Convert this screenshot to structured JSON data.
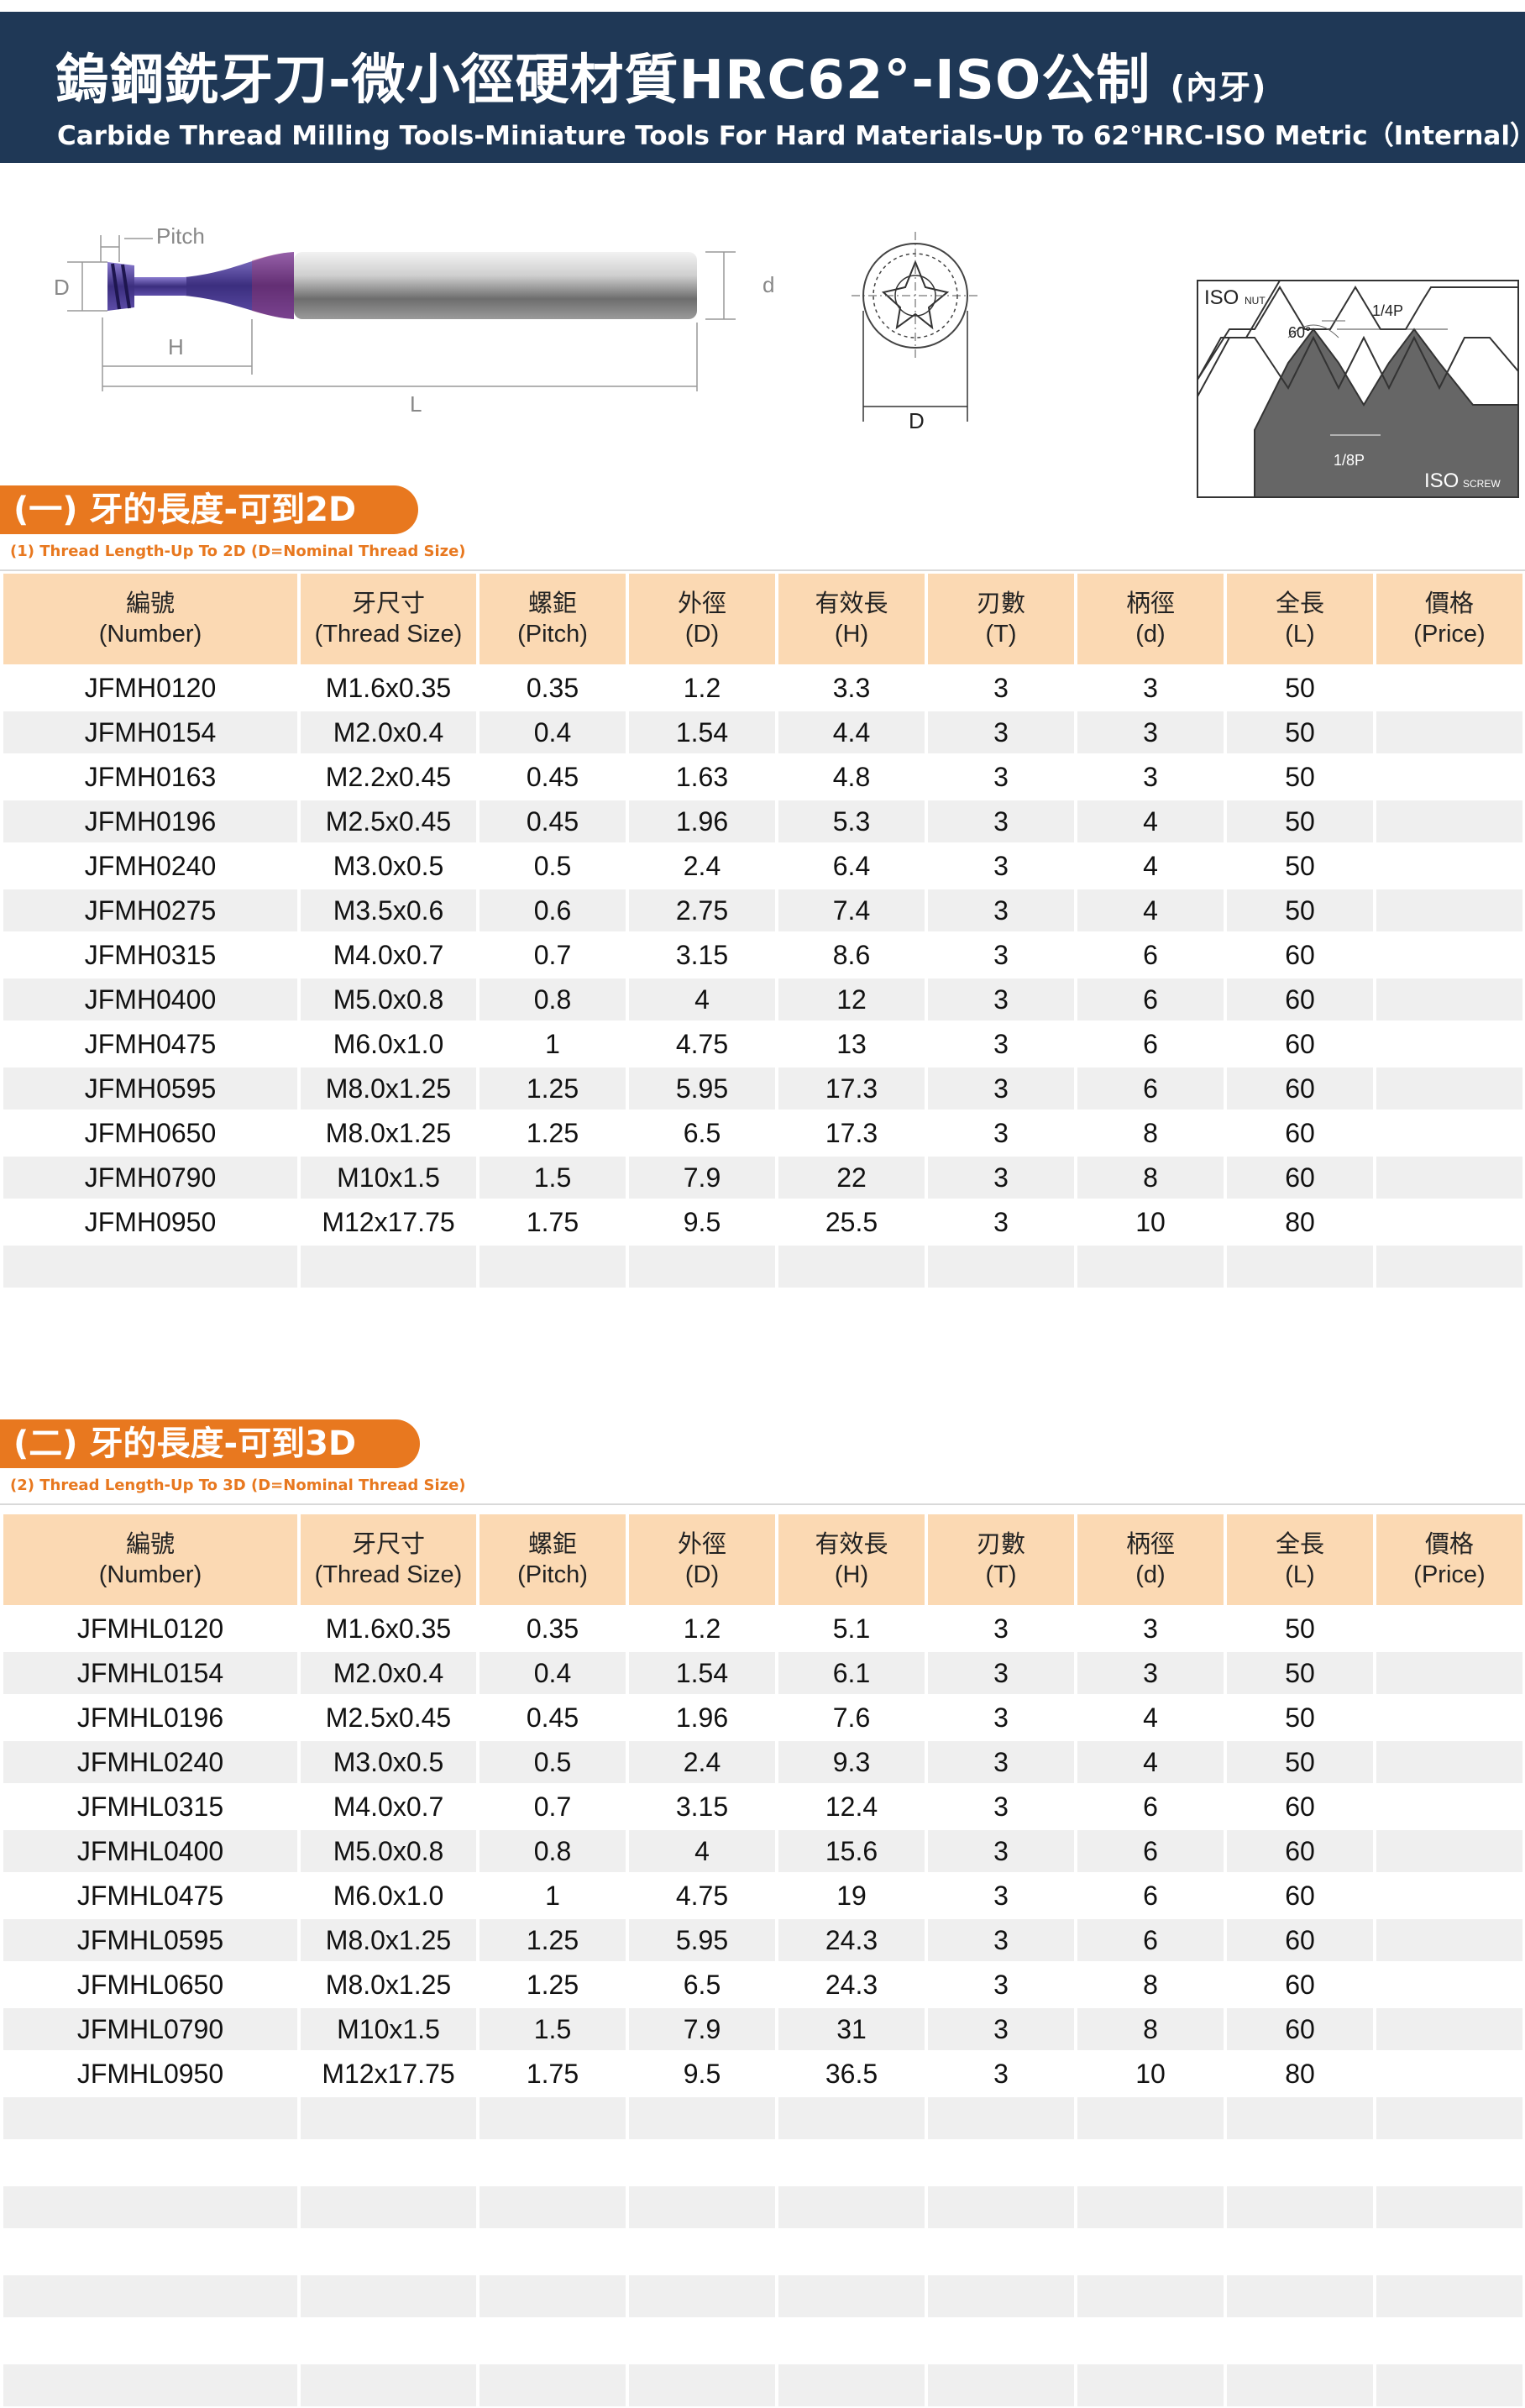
{
  "header": {
    "title_zh": "鎢鋼銑牙刀-微小徑硬材質HRC62°-ISO公制",
    "title_suffix": "(內牙)",
    "subtitle": "Carbide Thread Milling Tools-Miniature Tools For Hard Materials-Up To 62°HRC-ISO Metric（Internal）"
  },
  "tool_diagram": {
    "pitch_label": "Pitch",
    "d_outer_label": "D",
    "h_label": "H",
    "l_label": "L",
    "d_shank_label": "d",
    "end_view_label": "D"
  },
  "iso_diagram": {
    "nut_label": "ISO",
    "nut_sub": "NUT",
    "angle_label": "60°",
    "quarter_p": "1/4P",
    "eighth_p": "1/8P",
    "screw_label": "ISO",
    "screw_sub": "SCREW"
  },
  "columns": [
    {
      "zh": "編號",
      "en": "(Number)"
    },
    {
      "zh": "牙尺寸",
      "en": "(Thread Size)"
    },
    {
      "zh": "螺鉅",
      "en": "(Pitch)"
    },
    {
      "zh": "外徑",
      "en": "(D)"
    },
    {
      "zh": "有效長",
      "en": "(H)"
    },
    {
      "zh": "刃數",
      "en": "(T)"
    },
    {
      "zh": "柄徑",
      "en": "(d)"
    },
    {
      "zh": "全長",
      "en": "(L)"
    },
    {
      "zh": "價格",
      "en": "(Price)"
    }
  ],
  "section1": {
    "title": "(一) 牙的長度-可到2D",
    "subtitle": "(1) Thread Length-Up To 2D  (D=Nominal Thread Size)",
    "rows": [
      [
        "JFMH0120",
        "M1.6x0.35",
        "0.35",
        "1.2",
        "3.3",
        "3",
        "3",
        "50",
        ""
      ],
      [
        "JFMH0154",
        "M2.0x0.4",
        "0.4",
        "1.54",
        "4.4",
        "3",
        "3",
        "50",
        ""
      ],
      [
        "JFMH0163",
        "M2.2x0.45",
        "0.45",
        "1.63",
        "4.8",
        "3",
        "3",
        "50",
        ""
      ],
      [
        "JFMH0196",
        "M2.5x0.45",
        "0.45",
        "1.96",
        "5.3",
        "3",
        "4",
        "50",
        ""
      ],
      [
        "JFMH0240",
        "M3.0x0.5",
        "0.5",
        "2.4",
        "6.4",
        "3",
        "4",
        "50",
        ""
      ],
      [
        "JFMH0275",
        "M3.5x0.6",
        "0.6",
        "2.75",
        "7.4",
        "3",
        "4",
        "50",
        ""
      ],
      [
        "JFMH0315",
        "M4.0x0.7",
        "0.7",
        "3.15",
        "8.6",
        "3",
        "6",
        "60",
        ""
      ],
      [
        "JFMH0400",
        "M5.0x0.8",
        "0.8",
        "4",
        "12",
        "3",
        "6",
        "60",
        ""
      ],
      [
        "JFMH0475",
        "M6.0x1.0",
        "1",
        "4.75",
        "13",
        "3",
        "6",
        "60",
        ""
      ],
      [
        "JFMH0595",
        "M8.0x1.25",
        "1.25",
        "5.95",
        "17.3",
        "3",
        "6",
        "60",
        ""
      ],
      [
        "JFMH0650",
        "M8.0x1.25",
        "1.25",
        "6.5",
        "17.3",
        "3",
        "8",
        "60",
        ""
      ],
      [
        "JFMH0790",
        "M10x1.5",
        "1.5",
        "7.9",
        "22",
        "3",
        "8",
        "60",
        ""
      ],
      [
        "JFMH0950",
        "M12x17.75",
        "1.75",
        "9.5",
        "25.5",
        "3",
        "10",
        "80",
        ""
      ]
    ]
  },
  "section2": {
    "title": "(二) 牙的長度-可到3D",
    "subtitle": "(2) Thread Length-Up To 3D  (D=Nominal Thread Size)",
    "rows": [
      [
        "JFMHL0120",
        "M1.6x0.35",
        "0.35",
        "1.2",
        "5.1",
        "3",
        "3",
        "50",
        ""
      ],
      [
        "JFMHL0154",
        "M2.0x0.4",
        "0.4",
        "1.54",
        "6.1",
        "3",
        "3",
        "50",
        ""
      ],
      [
        "JFMHL0196",
        "M2.5x0.45",
        "0.45",
        "1.96",
        "7.6",
        "3",
        "4",
        "50",
        ""
      ],
      [
        "JFMHL0240",
        "M3.0x0.5",
        "0.5",
        "2.4",
        "9.3",
        "3",
        "4",
        "50",
        ""
      ],
      [
        "JFMHL0315",
        "M4.0x0.7",
        "0.7",
        "3.15",
        "12.4",
        "3",
        "6",
        "60",
        ""
      ],
      [
        "JFMHL0400",
        "M5.0x0.8",
        "0.8",
        "4",
        "15.6",
        "3",
        "6",
        "60",
        ""
      ],
      [
        "JFMHL0475",
        "M6.0x1.0",
        "1",
        "4.75",
        "19",
        "3",
        "6",
        "60",
        ""
      ],
      [
        "JFMHL0595",
        "M8.0x1.25",
        "1.25",
        "5.95",
        "24.3",
        "3",
        "6",
        "60",
        ""
      ],
      [
        "JFMHL0650",
        "M8.0x1.25",
        "1.25",
        "6.5",
        "24.3",
        "3",
        "8",
        "60",
        ""
      ],
      [
        "JFMHL0790",
        "M10x1.5",
        "1.5",
        "7.9",
        "31",
        "3",
        "8",
        "60",
        ""
      ],
      [
        "JFMHL0950",
        "M12x17.75",
        "1.75",
        "9.5",
        "36.5",
        "3",
        "10",
        "80",
        ""
      ]
    ]
  }
}
